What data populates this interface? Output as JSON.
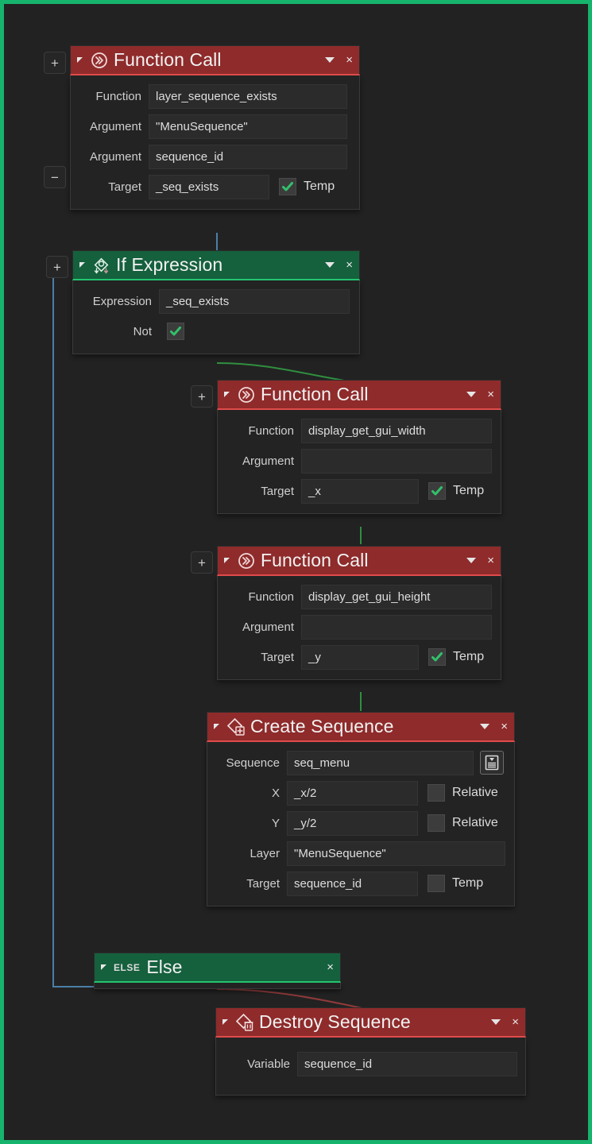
{
  "app": {
    "canvas_background": "#222222",
    "selection_border_color": "#16b36c",
    "node_red": "#8f2b2b",
    "node_red_accent": "#e04b4b",
    "node_green": "#15603d",
    "node_green_accent": "#23c46f",
    "wire_blue": "#4a7fa8",
    "wire_green": "#2f8f3f",
    "wire_red": "#8f3a3a"
  },
  "common": {
    "collapse_glyph": "◢",
    "caret_glyph": "▾",
    "close_glyph": "×",
    "plus_glyph": "+",
    "minus_glyph": "−",
    "temp_label": "Temp",
    "relative_label": "Relative"
  },
  "nodes": [
    {
      "id": "function-call-layer-sequence-exists",
      "title": "Function Call",
      "icon": "function-call-icon",
      "color": "red",
      "side_buttons": [
        "+",
        "−"
      ],
      "rows": [
        {
          "label": "Function",
          "value": "layer_sequence_exists"
        },
        {
          "label": "Argument",
          "value": "\"MenuSequence\""
        },
        {
          "label": "Argument",
          "value": "sequence_id"
        },
        {
          "label": "Target",
          "value": "_seq_exists",
          "checkbox": {
            "label": "Temp",
            "checked": true
          }
        }
      ]
    },
    {
      "id": "if-expression",
      "title": "If Expression",
      "icon": "if-branch-icon",
      "color": "green",
      "side_buttons": [
        "+"
      ],
      "rows": [
        {
          "label": "Expression",
          "value": "_seq_exists"
        },
        {
          "label": "Not",
          "checkbox_only": {
            "checked": true
          }
        }
      ]
    },
    {
      "id": "function-call-display-get-gui-width",
      "title": "Function Call",
      "icon": "function-call-icon",
      "color": "red",
      "side_buttons": [
        "+"
      ],
      "rows": [
        {
          "label": "Function",
          "value": "display_get_gui_width"
        },
        {
          "label": "Argument",
          "value": ""
        },
        {
          "label": "Target",
          "value": "_x",
          "checkbox": {
            "label": "Temp",
            "checked": true
          }
        }
      ]
    },
    {
      "id": "function-call-display-get-gui-height",
      "title": "Function Call",
      "icon": "function-call-icon",
      "color": "red",
      "side_buttons": [
        "+"
      ],
      "rows": [
        {
          "label": "Function",
          "value": "display_get_gui_height"
        },
        {
          "label": "Argument",
          "value": ""
        },
        {
          "label": "Target",
          "value": "_y",
          "checkbox": {
            "label": "Temp",
            "checked": true
          }
        }
      ]
    },
    {
      "id": "create-sequence",
      "title": "Create Sequence",
      "icon": "create-sequence-icon",
      "color": "red",
      "side_buttons": [],
      "rows": [
        {
          "label": "Sequence",
          "value": "seq_menu",
          "picker": "sequence-picker-icon"
        },
        {
          "label": "X",
          "value": "_x/2",
          "checkbox": {
            "label": "Relative",
            "checked": false
          }
        },
        {
          "label": "Y",
          "value": "_y/2",
          "checkbox": {
            "label": "Relative",
            "checked": false
          }
        },
        {
          "label": "Layer",
          "value": "\"MenuSequence\""
        },
        {
          "label": "Target",
          "value": "sequence_id",
          "checkbox": {
            "label": "Temp",
            "checked": false
          }
        }
      ]
    },
    {
      "id": "else",
      "title": "Else",
      "icon": "else-text-icon",
      "icon_text": "ELSE",
      "color": "green",
      "side_buttons": [],
      "rows": []
    },
    {
      "id": "destroy-sequence",
      "title": "Destroy Sequence",
      "icon": "destroy-sequence-icon",
      "color": "red",
      "side_buttons": [],
      "rows": [
        {
          "label": "Variable",
          "value": "sequence_id"
        }
      ]
    }
  ]
}
